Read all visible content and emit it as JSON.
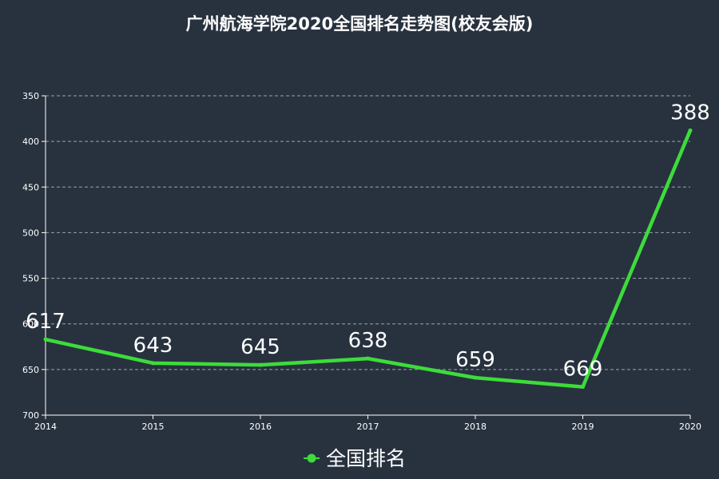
{
  "chart_data": {
    "type": "line",
    "title": "广州航海学院2020全国排名走势图(校友会版)",
    "categories": [
      "2014",
      "2015",
      "2016",
      "2017",
      "2018",
      "2019",
      "2020"
    ],
    "series": [
      {
        "name": "全国排名",
        "values": [
          617,
          643,
          645,
          638,
          659,
          669,
          388
        ]
      }
    ],
    "y_axis": {
      "inverted": true,
      "ylim": [
        350,
        700
      ],
      "ticks": [
        350,
        400,
        450,
        500,
        550,
        600,
        650,
        700
      ]
    },
    "grid": "horizontal-dashed",
    "legend_position": "bottom-center",
    "colors": {
      "background": "#28323f",
      "line": "#3ddc3a",
      "text": "#ffffff",
      "grid": "#9aa3ad"
    }
  }
}
